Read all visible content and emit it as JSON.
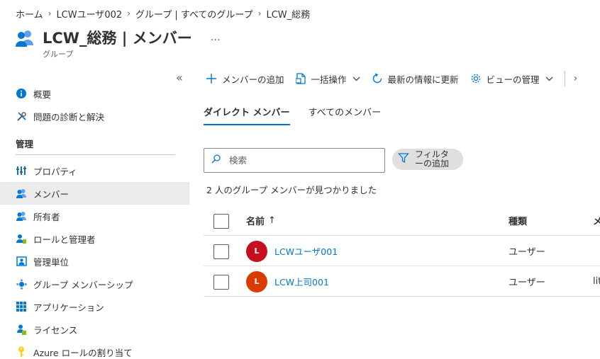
{
  "breadcrumb": {
    "items": [
      "ホーム",
      "LCWユーザ002",
      "グループ | すべてのグループ",
      "LCW_総務"
    ],
    "separator": "›"
  },
  "header": {
    "title": "LCW_総務 | メンバー",
    "subtitle": "グループ",
    "more": "…",
    "icon": "group-icon"
  },
  "sidebar": {
    "collapse_label": "«",
    "top_items": [
      {
        "label": "概要",
        "icon": "info-icon"
      },
      {
        "label": "問題の診断と解決",
        "icon": "wrench-icon"
      }
    ],
    "section_label": "管理",
    "items": [
      {
        "label": "プロパティ",
        "icon": "properties-icon"
      },
      {
        "label": "メンバー",
        "icon": "members-icon",
        "active": true
      },
      {
        "label": "所有者",
        "icon": "owners-icon"
      },
      {
        "label": "ロールと管理者",
        "icon": "roles-icon"
      },
      {
        "label": "管理単位",
        "icon": "admin-units-icon"
      },
      {
        "label": "グループ メンバーシップ",
        "icon": "group-membership-icon"
      },
      {
        "label": "アプリケーション",
        "icon": "applications-icon"
      },
      {
        "label": "ライセンス",
        "icon": "licenses-icon"
      },
      {
        "label": "Azure ロールの割り当て",
        "icon": "key-icon"
      }
    ]
  },
  "toolbar": {
    "add_member": "メンバーの追加",
    "bulk": "一括操作",
    "refresh": "最新の情報に更新",
    "manage_view": "ビューの管理",
    "more": "›"
  },
  "tabs": [
    {
      "label": "ダイレクト メンバー",
      "active": true
    },
    {
      "label": "すべてのメンバー",
      "active": false
    }
  ],
  "search": {
    "placeholder": "検索",
    "value": ""
  },
  "filter": {
    "line1": "フィルタ",
    "line2": "ーの追加"
  },
  "result_count": "2 人のグループ メンバーが見つかりました",
  "table": {
    "headers": {
      "name": "名前",
      "sort": "↑",
      "type": "種類",
      "extra": "メ"
    },
    "rows": [
      {
        "initial": "L",
        "name": "LCWユーザ001",
        "type": "ユーザー",
        "extra": "",
        "avatar_color": "#c50f1f"
      },
      {
        "initial": "L",
        "name": "LCW上司001",
        "type": "ユーザー",
        "extra": "lit",
        "avatar_color": "#da3b01"
      }
    ]
  },
  "colors": {
    "accent": "#0078d4",
    "active_bg": "#ebebeb"
  }
}
